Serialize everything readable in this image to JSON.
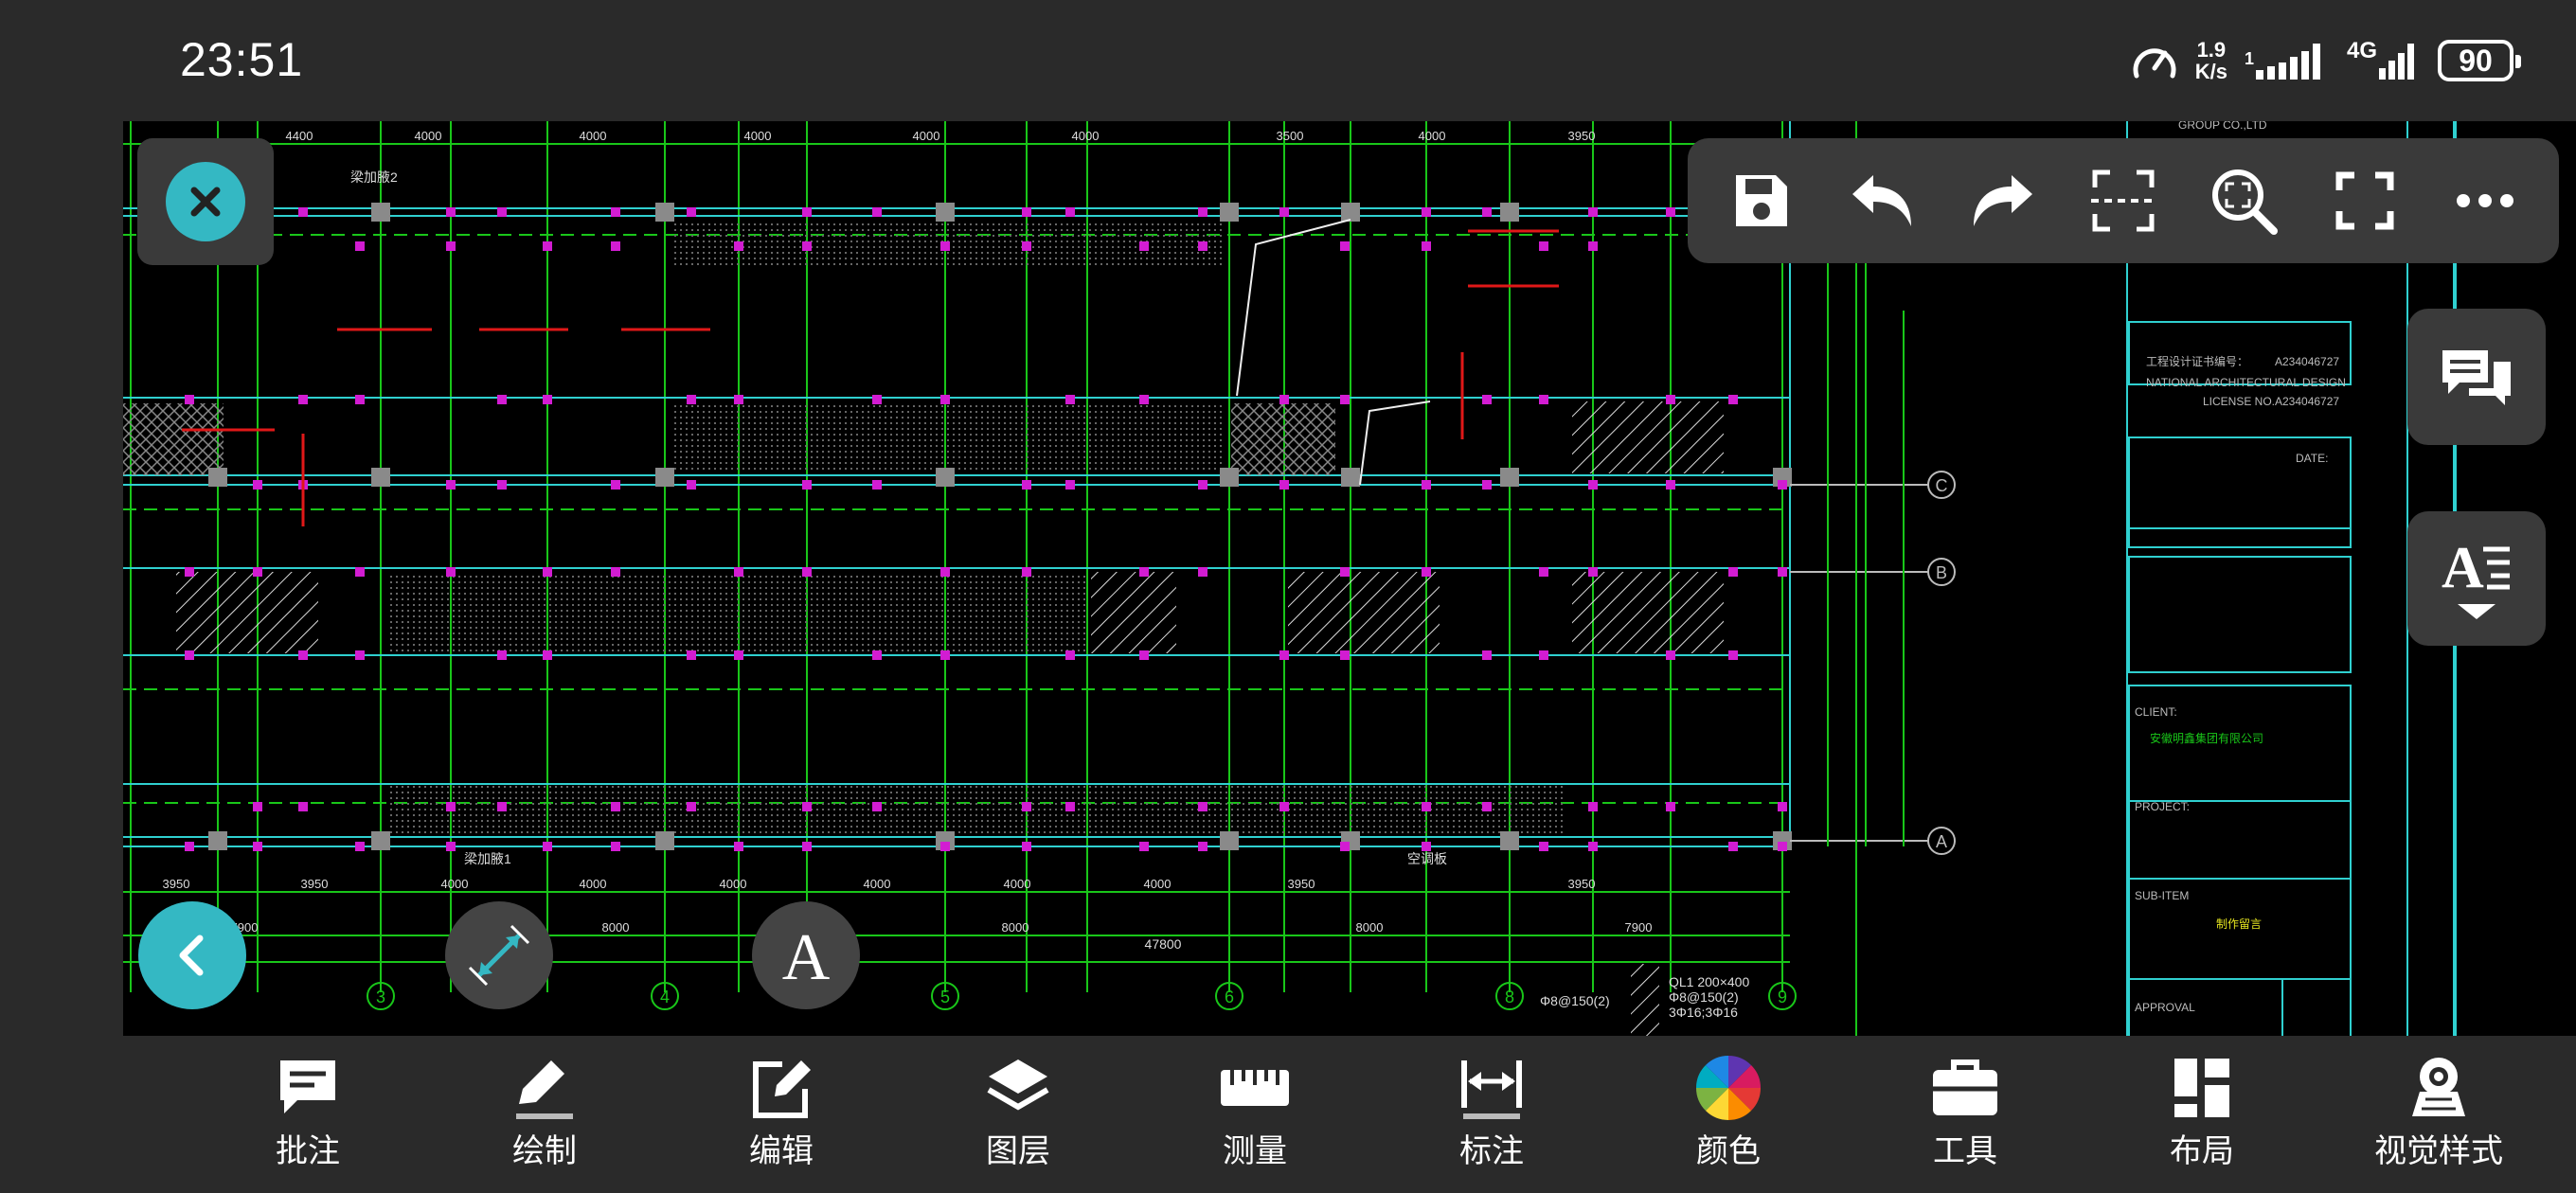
{
  "status_bar": {
    "time": "23:51",
    "net_speed_value": "1.9",
    "net_speed_unit": "K/s",
    "network_type": "4G",
    "battery": "90"
  },
  "drawing": {
    "title_block_company": "GROUP CO.,LTD",
    "dims_top": [
      "4400",
      "4000",
      "4000",
      "4000",
      "4000",
      "4000",
      "3500",
      "4000",
      "3950"
    ],
    "dims_bottom": [
      "3950",
      "3950",
      "4000",
      "4000",
      "4000",
      "4000",
      "4000",
      "4000",
      "3950",
      "3950"
    ],
    "dims_total": [
      "7900",
      "8000",
      "8000",
      "8000",
      "7900"
    ],
    "overall_dim": "47800",
    "axis_bottom": [
      "3",
      "4",
      "5",
      "6",
      "8",
      "9"
    ],
    "axis_right": [
      "C",
      "B",
      "A"
    ],
    "license_lines": [
      "工程设计证书编号：",
      "NATIONAL ARCHITECTURAL DESIGN",
      "LICENSE NO.",
      "A234046727",
      "A234046727"
    ],
    "client_name": "安徽明鑫集团有限公司",
    "project_label": "PROJECT:",
    "client_label": "CLIENT:",
    "subitem_label": "SUB-ITEM",
    "subitem_value": "制作留言",
    "approval_label": "APPROVAL",
    "date_label": "DATE:",
    "beam_note_1": "QL1 200×400",
    "beam_note_2": "Φ8@150(2)",
    "beam_note_3": "3Φ16;3Φ16",
    "rebar_note": "Φ8@150(2)",
    "section_label": "梁加腋1",
    "section_label_2": "空调板",
    "section_label_3": "梁加腋2"
  },
  "bottom_nav": [
    {
      "label": "批注",
      "icon": "comment-icon"
    },
    {
      "label": "绘制",
      "icon": "pencil-icon"
    },
    {
      "label": "编辑",
      "icon": "edit-icon"
    },
    {
      "label": "图层",
      "icon": "layers-icon"
    },
    {
      "label": "测量",
      "icon": "ruler-icon"
    },
    {
      "label": "标注",
      "icon": "dimension-icon"
    },
    {
      "label": "颜色",
      "icon": "color-wheel-icon"
    },
    {
      "label": "工具",
      "icon": "toolbox-icon"
    },
    {
      "label": "布局",
      "icon": "layout-icon"
    },
    {
      "label": "视觉样式",
      "icon": "visual-style-icon"
    }
  ],
  "colors": {
    "accent": "#34b8c3",
    "panel": "#3a3a3a",
    "background": "#2a2a2a",
    "cad_green": "#19c619",
    "cad_magenta": "#d21cd2",
    "cad_cyan": "#2fd0d0",
    "cad_red": "#e01818"
  }
}
